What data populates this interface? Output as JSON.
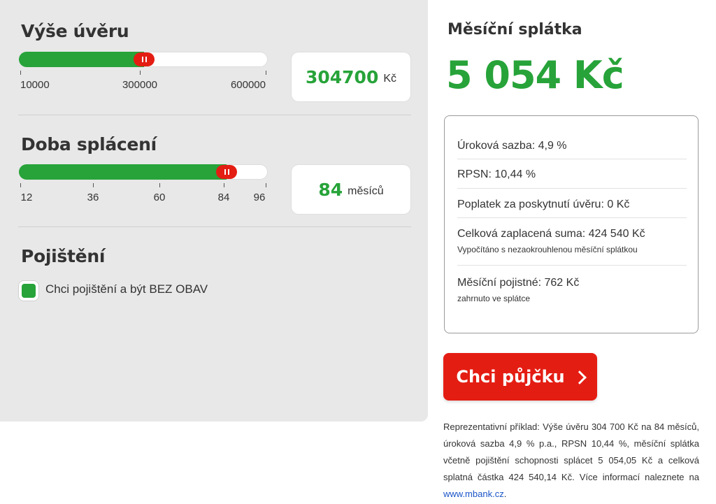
{
  "loan_amount": {
    "title": "Výše úvěru",
    "slider_fraction": 0.5041,
    "ticks": [
      "10000",
      "300000",
      "600000"
    ],
    "value": "304700",
    "unit": "Kč"
  },
  "term": {
    "title": "Doba splácení",
    "slider_fraction": 0.8333,
    "ticks": [
      "12",
      "36",
      "60",
      "84",
      "96"
    ],
    "value": "84",
    "unit": "měsíců"
  },
  "insurance": {
    "title": "Pojištění",
    "checkbox_label": "Chci pojištění a být BEZ OBAV",
    "checked": true
  },
  "summary": {
    "title": "Měsíční splátka",
    "amount": "5 054 Kč",
    "rows": [
      {
        "label": "Úroková sazba: 4,9 %"
      },
      {
        "label": "RPSN: 10,44 %"
      },
      {
        "label": "Poplatek za poskytnutí úvěru: 0 Kč"
      },
      {
        "label": "Celková zaplacená suma: 424 540 Kč",
        "note": "Vypočítáno s nezaokrouhlenou měsíční splátkou"
      },
      {
        "label": "Měsíční pojistné: 762 Kč",
        "note": "zahrnuto ve splátce"
      }
    ],
    "cta_label": "Chci půjčku"
  },
  "representative_example": {
    "text": "Reprezentativní příklad: Výše úvěru 304 700 Kč na 84 měsíců, úroková sazba 4,9 % p.a., RPSN 10,44 %, měsíční splátka včetně pojištění schopnosti splácet 5 054,05 Kč a celková splatná částka 424 540,14 Kč. Více informací naleznete na ",
    "link_text": "www.mbank.cz",
    "suffix": "."
  },
  "colors": {
    "accent_green": "#27a339",
    "accent_red": "#e41d13",
    "panel_gray": "#e8e8e8"
  },
  "icons": {
    "slider_thumb": "grip-bars-icon",
    "cta": "chevron-right-icon",
    "checkbox": "checkmark-square-icon"
  }
}
